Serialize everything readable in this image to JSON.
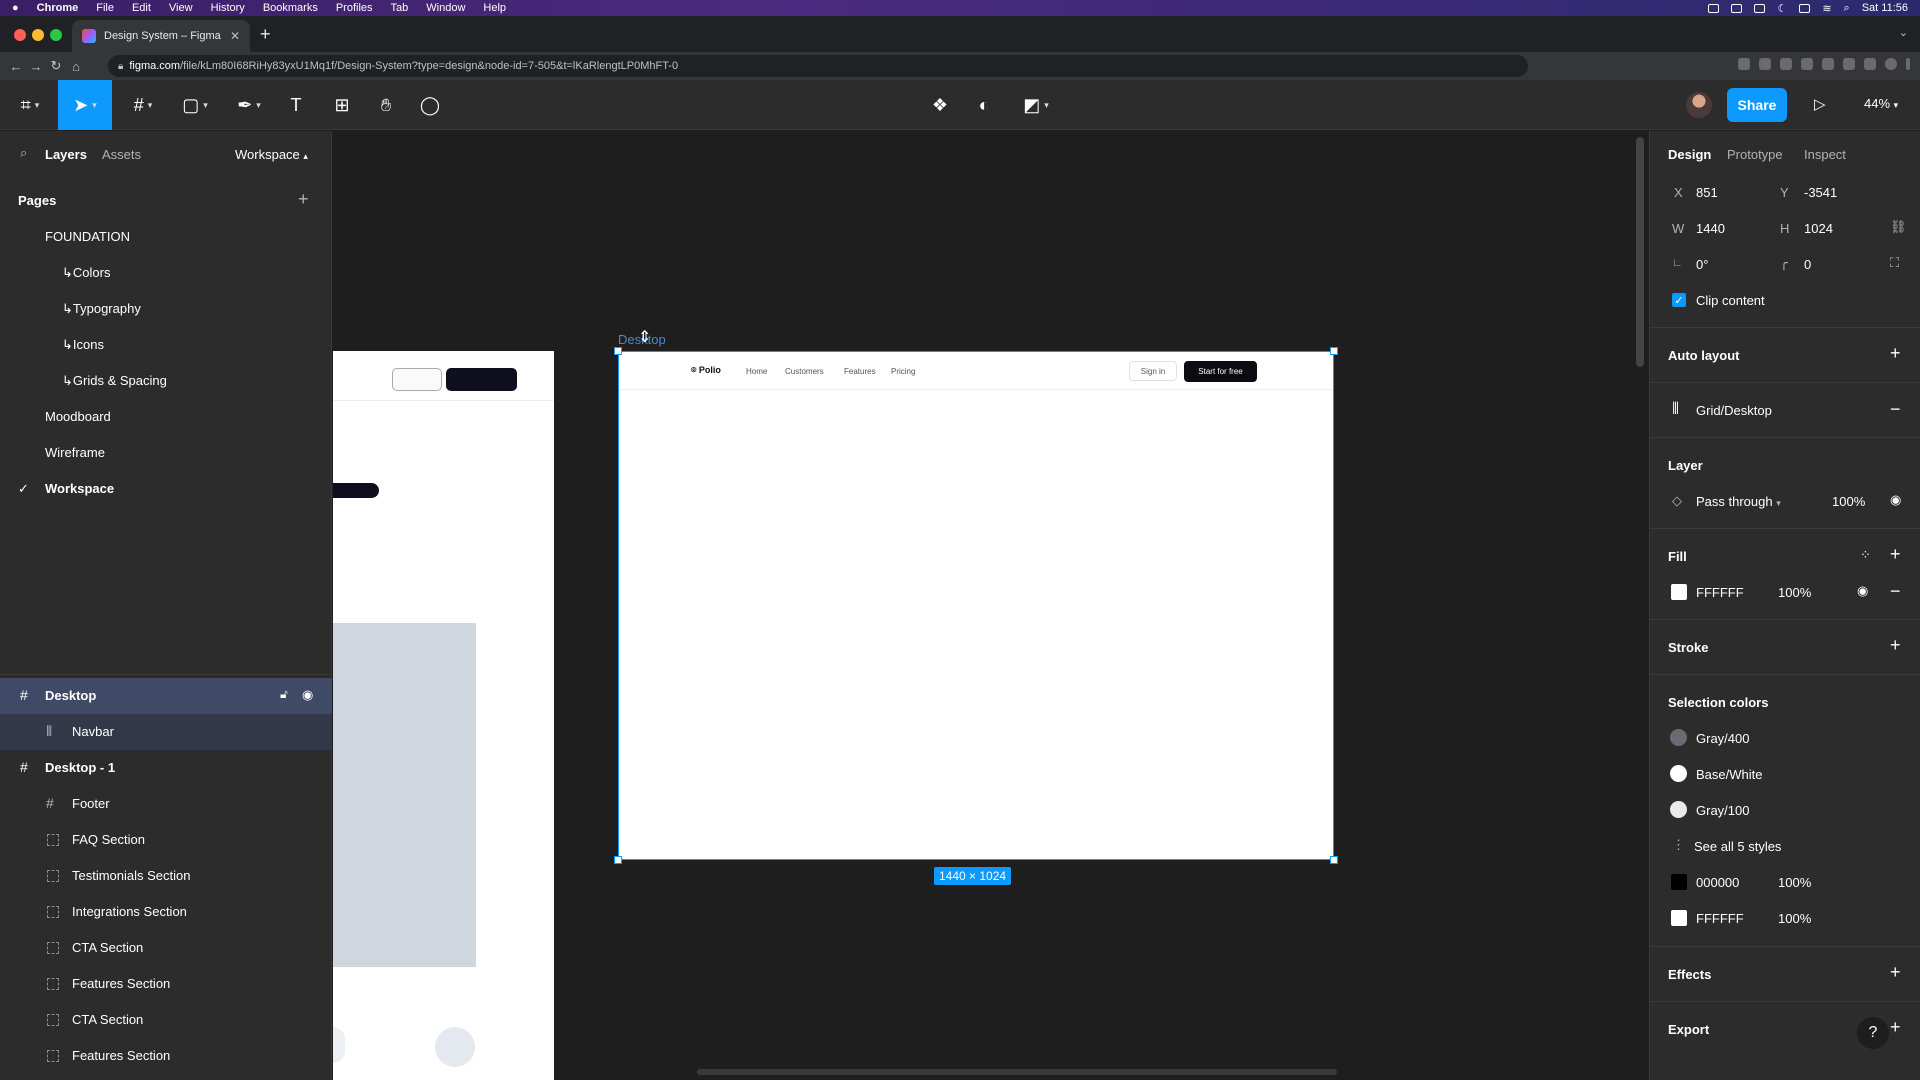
{
  "menubar": {
    "apple": "",
    "items": [
      "Chrome",
      "File",
      "Edit",
      "View",
      "History",
      "Bookmarks",
      "Profiles",
      "Tab",
      "Window",
      "Help"
    ],
    "clock": "Sat 11:56"
  },
  "browser": {
    "tab_title": "Design System – Figma",
    "url_host": "figma.com",
    "url_path": "/file/kLm80I68RiHy83yxU1Mq1f/Design-System?type=design&node-id=7-505&t=lKaRlengtLP0MhFT-0"
  },
  "toolbar": {
    "share_label": "Share",
    "zoom": "44%"
  },
  "left_panel": {
    "tabs": [
      "Layers",
      "Assets"
    ],
    "page_dropdown": "Workspace",
    "pages_title": "Pages",
    "pages": [
      {
        "label": "FOUNDATION"
      },
      {
        "label": "↳Colors"
      },
      {
        "label": "↳Typography"
      },
      {
        "label": "↳Icons"
      },
      {
        "label": "↳Grids & Spacing"
      },
      {
        "label": "Moodboard"
      },
      {
        "label": "Wireframe"
      },
      {
        "label": "Workspace",
        "current": true
      }
    ],
    "layers": [
      {
        "label": "Desktop",
        "type": "frame"
      },
      {
        "label": "Navbar",
        "type": "component"
      },
      {
        "label": "Desktop - 1",
        "type": "frame"
      },
      {
        "label": "Footer",
        "type": "frame-child"
      },
      {
        "label": "FAQ Section",
        "type": "section"
      },
      {
        "label": "Testimonials Section",
        "type": "section"
      },
      {
        "label": "Integrations Section",
        "type": "section"
      },
      {
        "label": "CTA Section",
        "type": "section"
      },
      {
        "label": "Features Section",
        "type": "section"
      },
      {
        "label": "CTA Section",
        "type": "section"
      },
      {
        "label": "Features Section",
        "type": "section"
      }
    ]
  },
  "canvas": {
    "frame_label": "Desktop",
    "frame_dims": "1440 × 1024",
    "navbar": {
      "logo": "Polio",
      "links": [
        "Home",
        "Customers",
        "Features",
        "Pricing"
      ],
      "signin": "Sign in",
      "cta": "Start for free"
    }
  },
  "right_panel": {
    "tabs": [
      "Design",
      "Prototype",
      "Inspect"
    ],
    "x_label": "X",
    "x": "851",
    "y_label": "Y",
    "y": "-3541",
    "w_label": "W",
    "w": "1440",
    "h_label": "H",
    "h": "1024",
    "rotation": "0°",
    "radius": "0",
    "clip_content": "Clip content",
    "auto_layout": "Auto layout",
    "grid": "Grid/Desktop",
    "layer_title": "Layer",
    "blend": "Pass through",
    "layer_opacity": "100%",
    "fill_title": "Fill",
    "fill_hex": "FFFFFF",
    "fill_opacity": "100%",
    "stroke_title": "Stroke",
    "selection_colors_title": "Selection colors",
    "selection_styles": [
      {
        "name": "Gray/400",
        "color": "#6b6b74"
      },
      {
        "name": "Base/White",
        "color": "#ffffff"
      },
      {
        "name": "Gray/100",
        "color": "#eaeaea"
      }
    ],
    "see_all": "See all 5 styles",
    "raw_colors": [
      {
        "hex": "000000",
        "opacity": "100%",
        "color": "#000000"
      },
      {
        "hex": "FFFFFF",
        "opacity": "100%",
        "color": "#ffffff"
      }
    ],
    "effects_title": "Effects",
    "export_title": "Export"
  }
}
